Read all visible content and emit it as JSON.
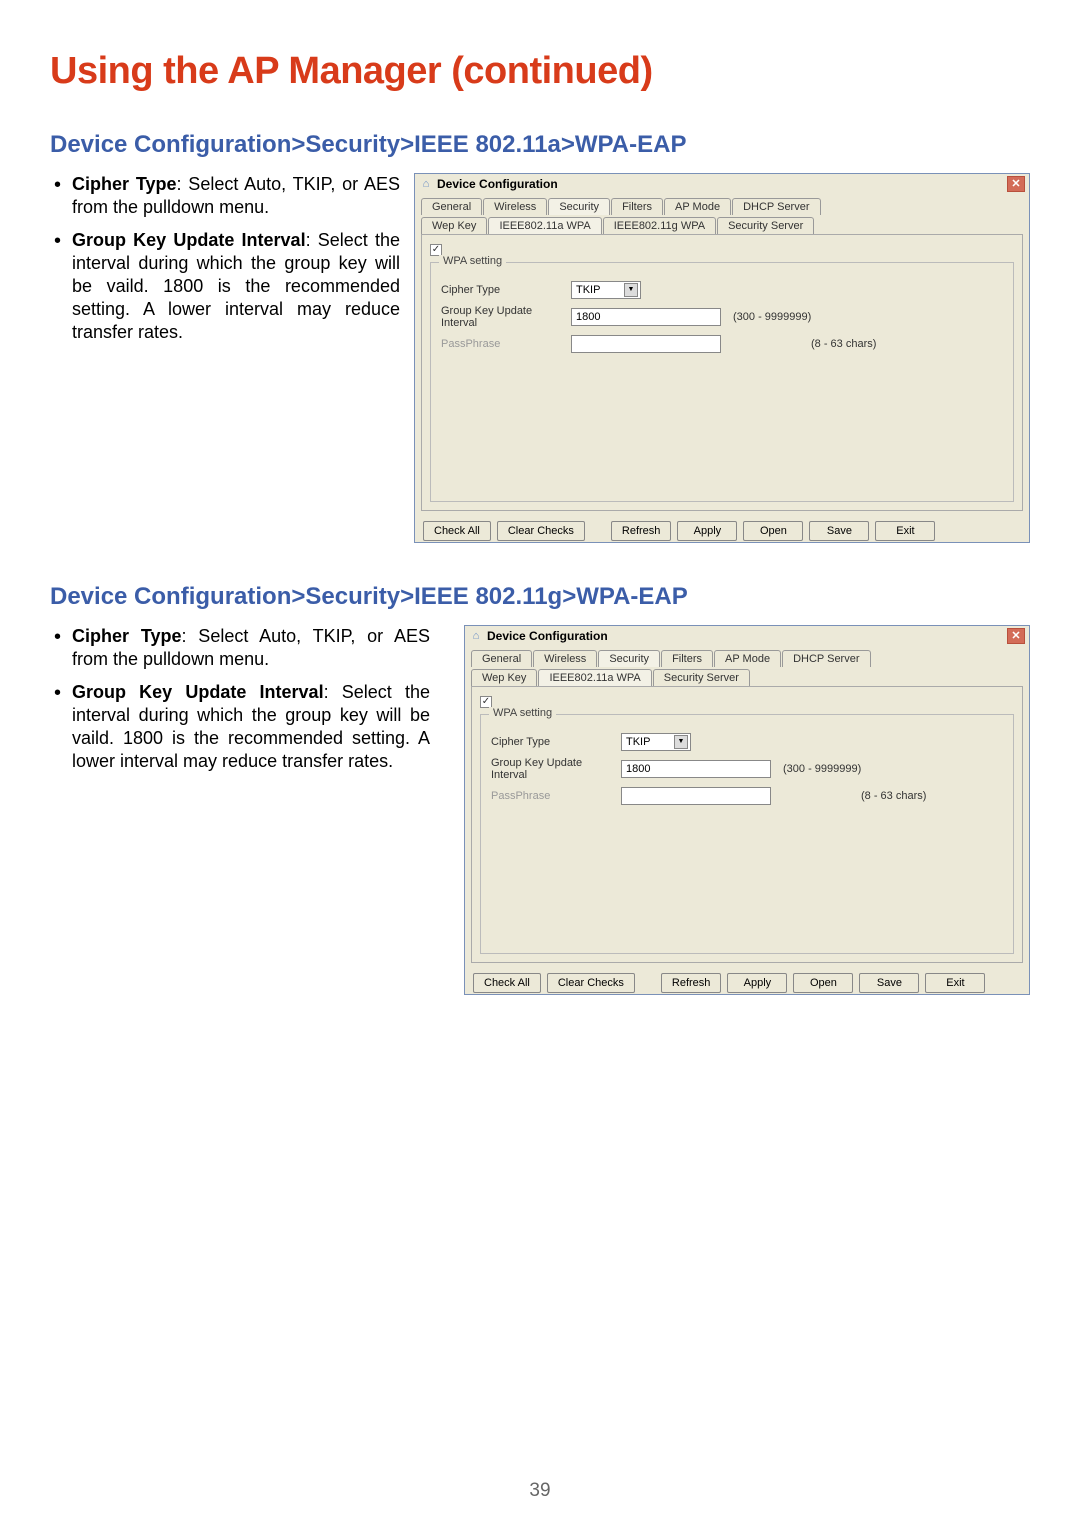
{
  "page_title": "Using the AP Manager (continued)",
  "page_number": "39",
  "section_a": {
    "heading": "Device Configuration>Security>IEEE 802.11a>WPA-EAP",
    "bullets": [
      {
        "term": "Cipher Type",
        "desc": ": Select Auto, TKIP, or AES from the pulldown menu."
      },
      {
        "term": "Group Key Update Interval",
        "desc": ": Select the interval during which the group key will be vaild. 1800 is the recommended setting. A lower interval may reduce transfer rates."
      }
    ],
    "dialog": {
      "title": "Device Configuration",
      "tabs": [
        "General",
        "Wireless",
        "Security",
        "Filters",
        "AP Mode",
        "DHCP Server"
      ],
      "subtabs": [
        "Wep Key",
        "IEEE802.11a WPA",
        "IEEE802.11g WPA",
        "Security Server"
      ],
      "checkbox_checked": true,
      "fieldset_label": "WPA setting",
      "cipher_label": "Cipher Type",
      "cipher_value": "TKIP",
      "gkui_label": "Group Key Update Interval",
      "gkui_value": "1800",
      "gkui_hint": "(300 - 9999999)",
      "pass_label": "PassPhrase",
      "pass_hint": "(8 - 63 chars)",
      "buttons": [
        "Check All",
        "Clear Checks",
        "Refresh",
        "Apply",
        "Open",
        "Save",
        "Exit"
      ]
    }
  },
  "section_g": {
    "heading": "Device Configuration>Security>IEEE 802.11g>WPA-EAP",
    "bullets": [
      {
        "term": "Cipher Type",
        "desc": ": Select Auto, TKIP, or AES from the pulldown menu."
      },
      {
        "term": "Group Key Update Interval",
        "desc": ": Select the interval during which the group key will be vaild. 1800 is the recommended setting. A lower interval may reduce transfer rates."
      }
    ],
    "dialog": {
      "title": "Device Configuration",
      "tabs": [
        "General",
        "Wireless",
        "Security",
        "Filters",
        "AP Mode",
        "DHCP Server"
      ],
      "subtabs": [
        "Wep Key",
        "IEEE802.11a WPA",
        "Security Server"
      ],
      "checkbox_checked": true,
      "fieldset_label": "WPA setting",
      "cipher_label": "Cipher Type",
      "cipher_value": "TKIP",
      "gkui_label": "Group Key Update Interval",
      "gkui_value": "1800",
      "gkui_hint": "(300 - 9999999)",
      "pass_label": "PassPhrase",
      "pass_hint": "(8 - 63 chars)",
      "buttons": [
        "Check All",
        "Clear Checks",
        "Refresh",
        "Apply",
        "Open",
        "Save",
        "Exit"
      ]
    }
  }
}
